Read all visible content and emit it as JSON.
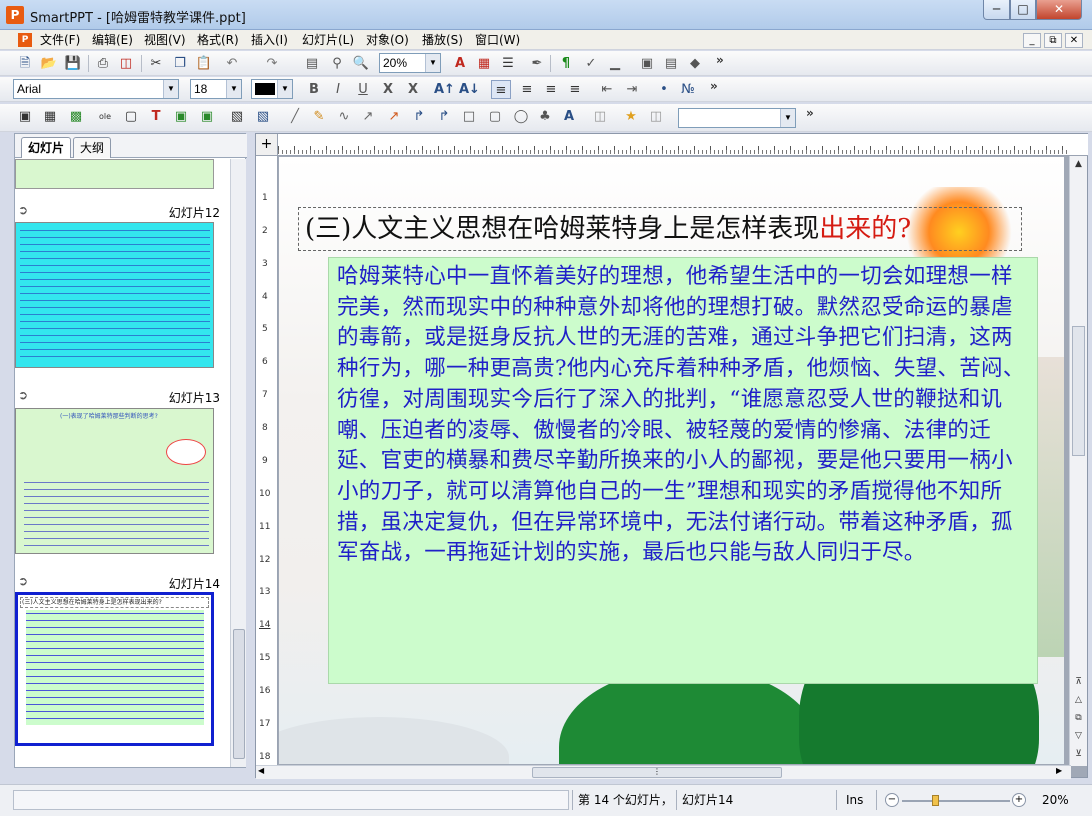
{
  "window": {
    "app_name": "SmartPPT",
    "title": "SmartPPT - [哈姆雷特教学课件.ppt]",
    "app_icon_letter": "P"
  },
  "menu": [
    "文件(F)",
    "编辑(E)",
    "视图(V)",
    "格式(R)",
    "插入(I)",
    "幻灯片(L)",
    "对象(O)",
    "播放(S)",
    "窗口(W)"
  ],
  "toolbar_standard": {
    "zoom_value": "20%"
  },
  "toolbar_format": {
    "font_family": "Arial",
    "font_size": "18",
    "bold_label": "B",
    "italic_label": "I",
    "underline_label": "U",
    "strike_label": "X",
    "x_label": "X"
  },
  "panel_tabs": [
    "幻灯片",
    "大纲"
  ],
  "slides": [
    {
      "label": "幻灯片12",
      "active": false,
      "thumb_title": "",
      "color": "#33e6ee"
    },
    {
      "label": "幻灯片13",
      "active": false,
      "thumb_title": "(一)表现了哈姆莱特那些判断的思考?",
      "color": "#d9f7cf"
    },
    {
      "label": "幻灯片14",
      "active": true,
      "thumb_title": "(三)人文主义思想在哈姆莱特身上是怎样表现出来的?",
      "color": "#ffffff"
    }
  ],
  "slide": {
    "title_black": "(三)人文主义思想在哈姆莱特身上是怎样表现",
    "title_red": "出来的?",
    "body": "哈姆莱特心中一直怀着美好的理想，他希望生活中的一切会如理想一样完美，然而现实中的种种意外却将他的理想打破。默然忍受命运的暴虐的毒箭，或是挺身反抗人世的无涯的苦难，通过斗争把它们扫清，这两种行为，哪一种更高贵?他内心充斥着种种矛盾，他烦恼、失望、苦闷、彷徨，对周围现实今后行了深入的批判，“谁愿意忍受人世的鞭挞和讥嘲、压迫者的凌辱、傲慢者的冷眼、被轻蔑的爱情的惨痛、法律的迁延、官吏的横暴和费尽辛勤所换来的小人的鄙视，要是他只要用一柄小小的刀子，就可以清算他自己的一生”理想和现实的矛盾搅得他不知所措，虽决定复仇，但在异常环境中，无法付诸行动。带着这种矛盾，孤军奋战，一再拖延计划的实施，最后也只能与敌人同归于尽。"
  },
  "ruler": {
    "vertical_numbers": [
      "1",
      "2",
      "3",
      "4",
      "5",
      "6",
      "7",
      "8",
      "9",
      "10",
      "11",
      "12",
      "13",
      "14",
      "15",
      "16",
      "17",
      "18"
    ]
  },
  "status": {
    "slide_position": "第 14 个幻灯片，",
    "slide_name": "幻灯片14",
    "mode": "Ins",
    "zoom": "20%"
  },
  "colors": {
    "title_red": "#d51b12",
    "body_blue": "#2020c8",
    "textbox_bg": "#ccfccc",
    "active_slide_border": "#1020d0"
  }
}
